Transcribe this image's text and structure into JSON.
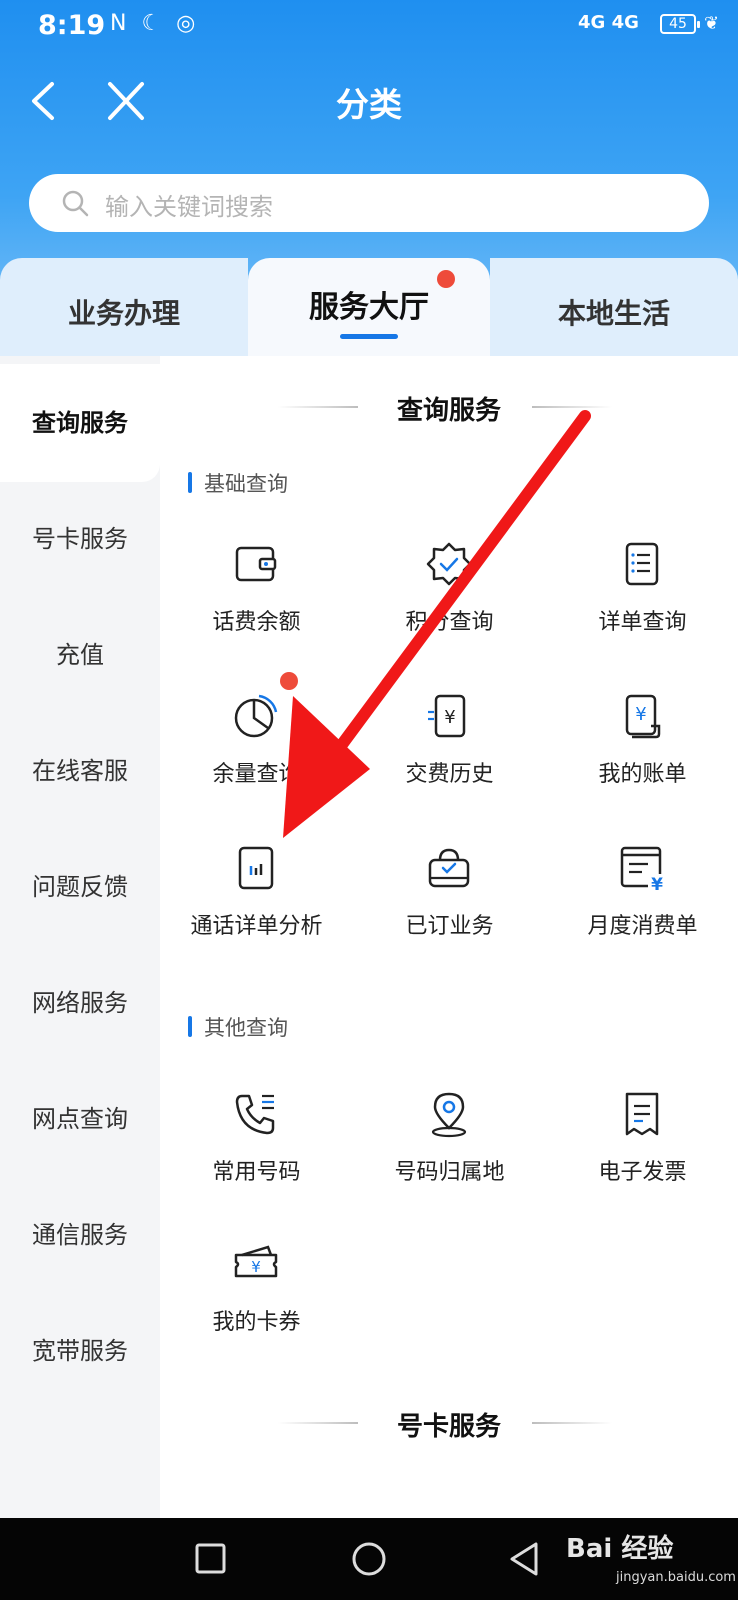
{
  "status_bar": {
    "time": "8:19",
    "signal": "4G 4G",
    "battery": "45"
  },
  "header": {
    "title": "分类"
  },
  "search": {
    "placeholder": "输入关键词搜索"
  },
  "tabs": [
    {
      "label": "业务办理"
    },
    {
      "label": "服务大厅",
      "active": true,
      "badge": true
    },
    {
      "label": "本地生活"
    }
  ],
  "sidebar": {
    "items": [
      {
        "label": "查询服务",
        "active": true
      },
      {
        "label": "号卡服务"
      },
      {
        "label": "充值"
      },
      {
        "label": "在线客服"
      },
      {
        "label": "问题反馈"
      },
      {
        "label": "网络服务"
      },
      {
        "label": "网点查询"
      },
      {
        "label": "通信服务"
      },
      {
        "label": "宽带服务"
      }
    ]
  },
  "main": {
    "section_title": "查询服务",
    "next_section_title": "号卡服务",
    "groups": [
      {
        "title": "基础查询",
        "items": [
          {
            "label": "话费余额",
            "icon": "wallet-icon"
          },
          {
            "label": "积分查询",
            "icon": "badge-check-icon"
          },
          {
            "label": "详单查询",
            "icon": "list-doc-icon"
          },
          {
            "label": "余量查询",
            "icon": "pie-chart-icon",
            "badge": true
          },
          {
            "label": "交费历史",
            "icon": "yen-doc-icon"
          },
          {
            "label": "我的账单",
            "icon": "bill-icon"
          },
          {
            "label": "通话详单分析",
            "icon": "bar-chart-icon"
          },
          {
            "label": "已订业务",
            "icon": "bag-check-icon"
          },
          {
            "label": "月度消费单",
            "icon": "monthly-bill-icon"
          }
        ]
      },
      {
        "title": "其他查询",
        "items": [
          {
            "label": "常用号码",
            "icon": "phone-list-icon"
          },
          {
            "label": "号码归属地",
            "icon": "location-pin-icon"
          },
          {
            "label": "电子发票",
            "icon": "invoice-icon"
          },
          {
            "label": "我的卡券",
            "icon": "coupon-icon"
          }
        ]
      }
    ]
  },
  "watermark": {
    "brand": "Bai 经验",
    "url": "jingyan.baidu.com"
  },
  "colors": {
    "accent": "#1677e6",
    "header_top": "#1f8ff0",
    "badge": "#ee4b3a",
    "arrow": "#f01818"
  }
}
